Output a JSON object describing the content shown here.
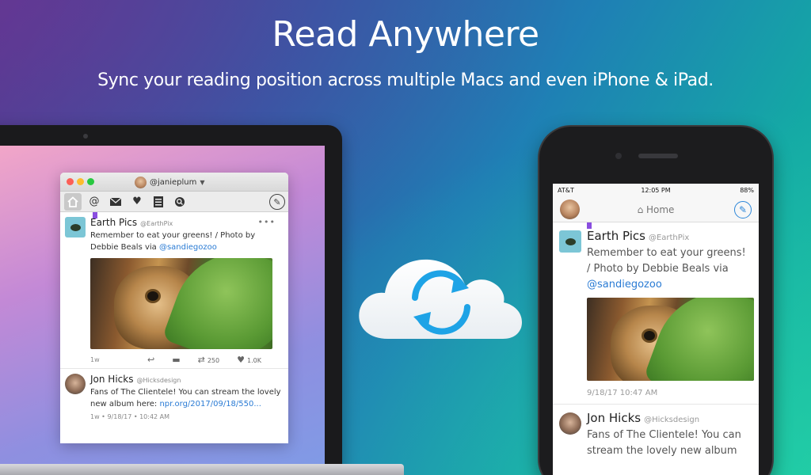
{
  "hero": {
    "title": "Read Anywhere",
    "subtitle": "Sync your reading position across multiple Macs and even iPhone & iPad."
  },
  "mac_app": {
    "account": "@janieplum",
    "toolbar_icons": [
      "home-icon",
      "mentions-icon",
      "messages-icon",
      "likes-icon",
      "lists-icon",
      "search-icon",
      "compose-icon"
    ],
    "tweets": [
      {
        "name": "Earth Pics",
        "handle": "@EarthPix",
        "text": "Remember to eat your greens! / Photo by Debbie Beals via ",
        "link": "@sandiegozoo",
        "age": "1w",
        "retweets": "250",
        "likes": "1.0K",
        "more": "•••"
      },
      {
        "name": "Jon Hicks",
        "handle": "@Hicksdesign",
        "text": "Fans of The Clientele! You can stream the lovely new album here: ",
        "link": "npr.org/2017/09/18/550...",
        "meta": "1w • 9/18/17 • 10:42 AM"
      }
    ]
  },
  "phone_app": {
    "carrier": "AT&T",
    "time": "12:05 PM",
    "battery": "88%",
    "nav_title": "Home",
    "tweets": [
      {
        "name": "Earth Pics",
        "handle": "@EarthPix",
        "text": "Remember to eat your greens! / Photo by Debbie Beals via ",
        "link": "@sandiegozoo",
        "meta": "9/18/17 10:47 AM"
      },
      {
        "name": "Jon Hicks",
        "handle": "@Hicksdesign",
        "text": "Fans of The Clientele! You can stream the lovely new album"
      }
    ]
  },
  "colors": {
    "link": "#2a7bd4",
    "bookmark": "#8a4ee0",
    "sync_arrows": "#1ea3e6"
  }
}
